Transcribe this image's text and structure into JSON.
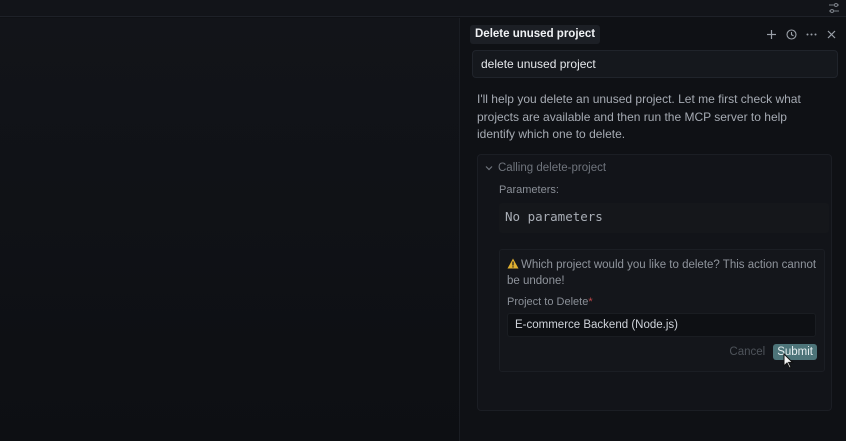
{
  "panel": {
    "tab_title": "Delete unused project",
    "prompt": "delete unused project",
    "assistant_message": "I'll help you delete an unused project. Let me first check what projects are available and then run the MCP server to help identify which one to delete."
  },
  "tool_call": {
    "title": "Calling delete-project",
    "params_label": "Parameters:",
    "params_value": "No parameters",
    "confirm": {
      "warning": "Which project would you like to delete? This action cannot be undone!",
      "field_label": "Project to Delete",
      "required_mark": "*",
      "selected_value": "E-commerce Backend (Node.js)",
      "cancel_label": "Cancel",
      "submit_label": "Submit"
    }
  },
  "icons": [
    "settings-icon",
    "plus-icon",
    "history-icon",
    "more-icon",
    "close-icon",
    "chevron-down-icon",
    "warning-icon",
    "cursor-icon"
  ],
  "colors": {
    "accent": "#4d7479",
    "required": "#c0484a",
    "warning": "#e0b030"
  }
}
